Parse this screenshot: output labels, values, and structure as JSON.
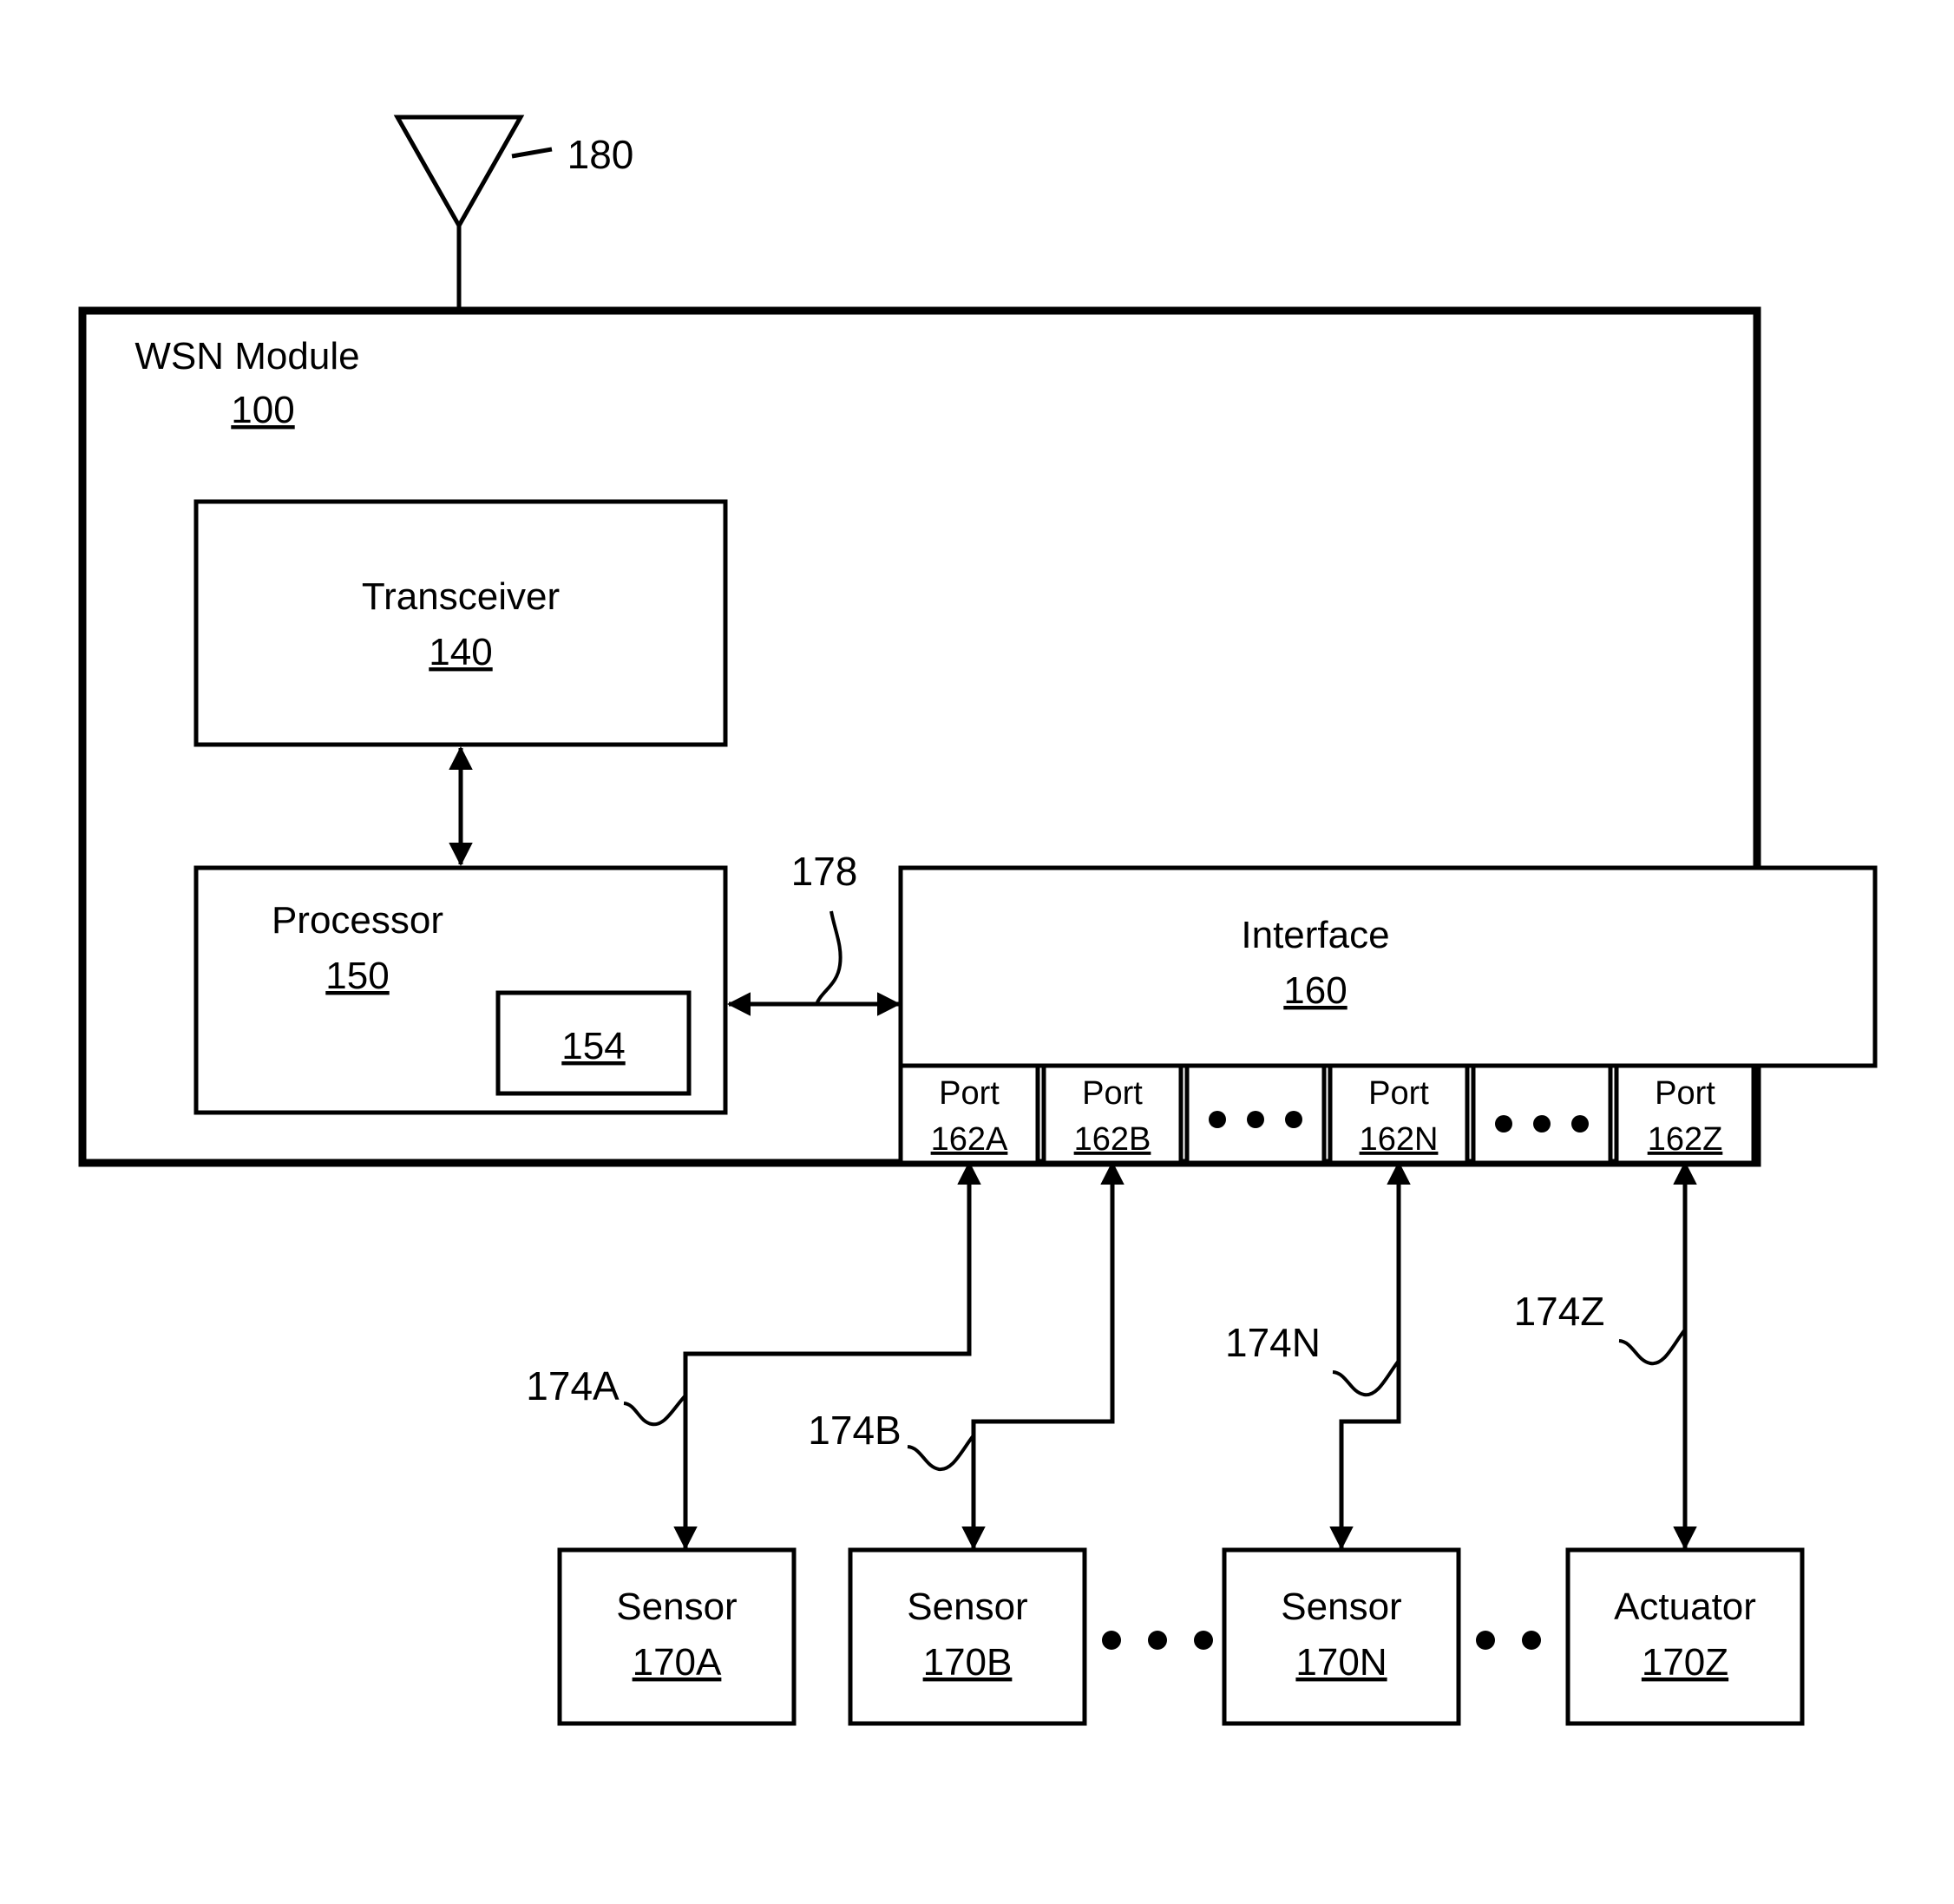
{
  "figure": {
    "title": "WSN Module block diagram",
    "background_color": "#ffffff",
    "line_color": "#000000"
  },
  "antenna": {
    "name": "antenna",
    "ref": "180"
  },
  "module": {
    "label": "WSN Module",
    "ref": "100"
  },
  "transceiver": {
    "label": "Transceiver",
    "ref": "140"
  },
  "processor": {
    "label": "Processor",
    "ref": "150",
    "inner_ref": "154"
  },
  "interface": {
    "label": "Interface",
    "ref": "160"
  },
  "bus": {
    "ref": "178"
  },
  "ports": [
    {
      "label": "Port",
      "ref": "162A",
      "type": "port"
    },
    {
      "label": "Port",
      "ref": "162B",
      "type": "port"
    },
    {
      "label": "",
      "ref": "",
      "type": "ellipsis"
    },
    {
      "label": "Port",
      "ref": "162N",
      "type": "port"
    },
    {
      "label": "",
      "ref": "",
      "type": "ellipsis"
    },
    {
      "label": "Port",
      "ref": "162Z",
      "type": "port"
    }
  ],
  "devices": [
    {
      "label": "Sensor",
      "ref": "170A",
      "type": "device"
    },
    {
      "label": "Sensor",
      "ref": "170B",
      "type": "device"
    },
    {
      "label": "",
      "ref": "",
      "type": "ellipsis"
    },
    {
      "label": "Sensor",
      "ref": "170N",
      "type": "device"
    },
    {
      "label": "",
      "ref": "",
      "type": "ellipsis"
    },
    {
      "label": "Actuator",
      "ref": "170Z",
      "type": "device"
    }
  ],
  "links": [
    {
      "ref": "174A"
    },
    {
      "ref": "174B"
    },
    {
      "ref": "174N"
    },
    {
      "ref": "174Z"
    }
  ]
}
